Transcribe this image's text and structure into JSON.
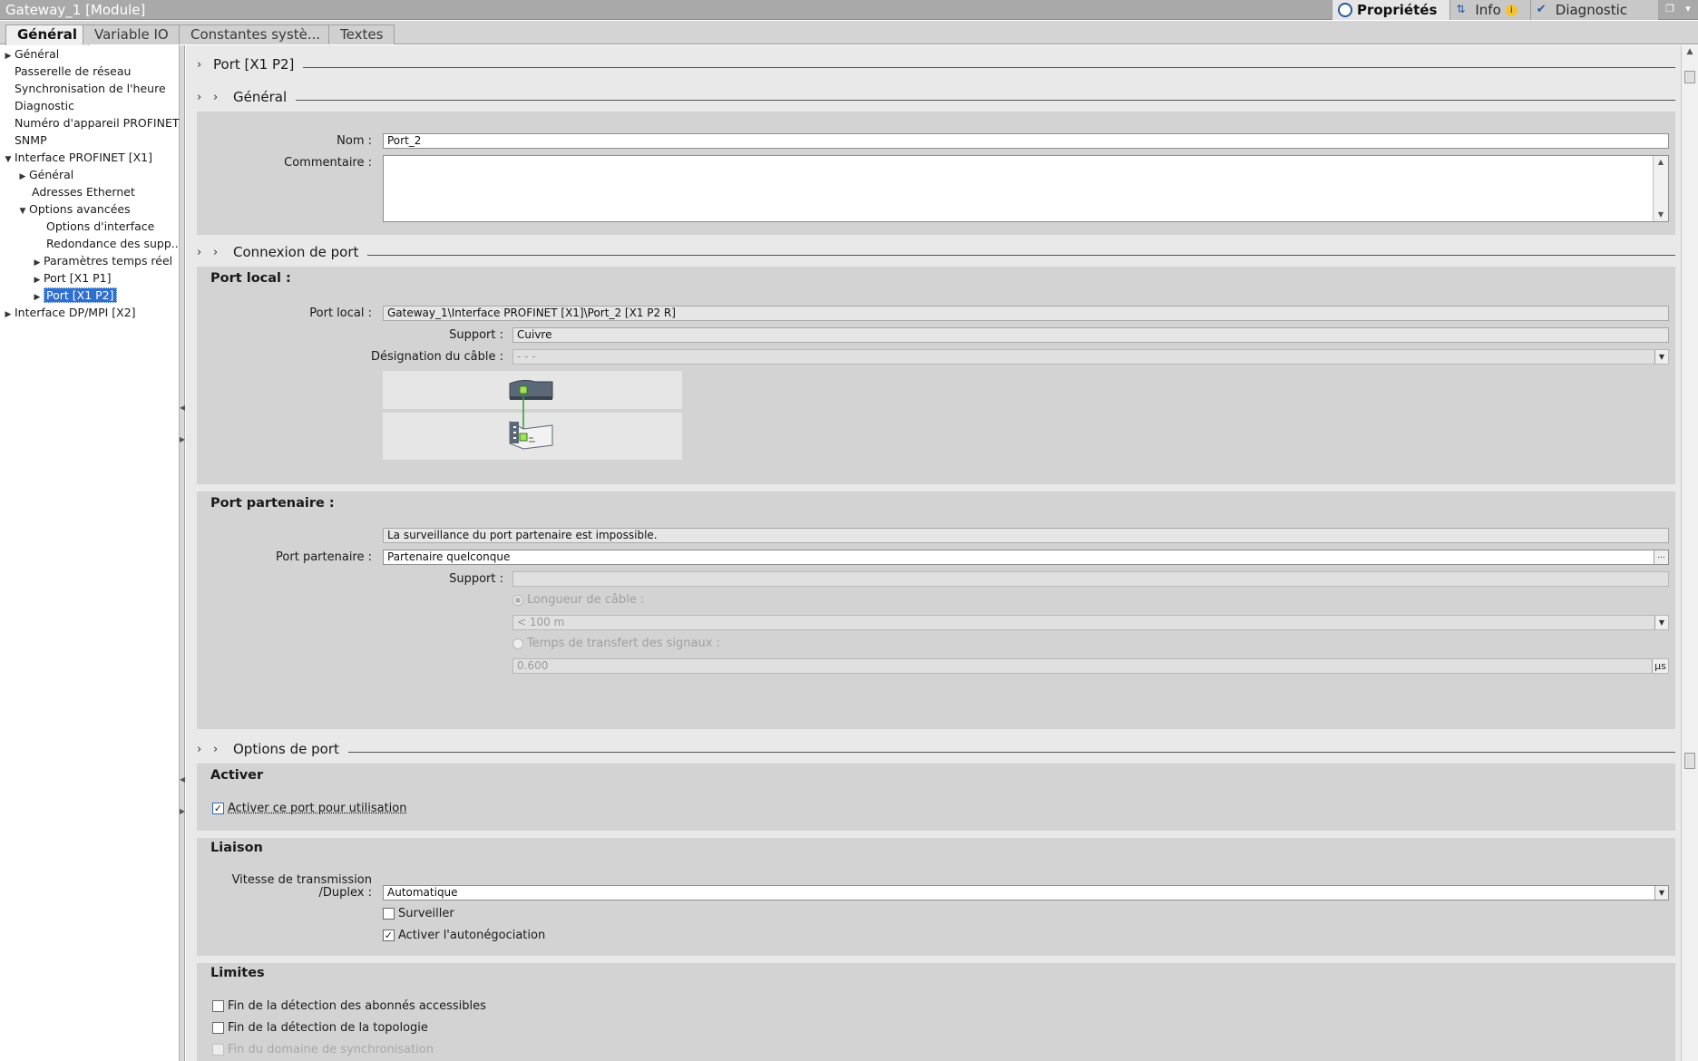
{
  "window": {
    "title": "Gateway_1 [Module]"
  },
  "top_tabs": [
    {
      "label": "Propriétés",
      "icon": "properties-icon"
    },
    {
      "label": "Info",
      "icon": "info-icon"
    },
    {
      "label": "Diagnostic",
      "icon": "diagnostic-icon"
    }
  ],
  "tabs": [
    "Général",
    "Variable IO",
    "Constantes systè...",
    "Textes"
  ],
  "tree": [
    {
      "label": "Général"
    },
    {
      "label": "Passerelle de réseau"
    },
    {
      "label": "Synchronisation de l'heure"
    },
    {
      "label": "Diagnostic"
    },
    {
      "label": "Numéro d'appareil PROFINET"
    },
    {
      "label": "SNMP"
    },
    {
      "label": "Interface PROFINET [X1]"
    },
    {
      "label": "Général"
    },
    {
      "label": "Adresses Ethernet"
    },
    {
      "label": "Options avancées"
    },
    {
      "label": "Options d'interface"
    },
    {
      "label": "Redondance des supp..."
    },
    {
      "label": "Paramètres temps réel"
    },
    {
      "label": "Port [X1 P1]"
    },
    {
      "label": "Port [X1 P2]"
    },
    {
      "label": "Interface DP/MPI [X2]"
    }
  ],
  "sections": {
    "port_header": "Port [X1 P2]",
    "general": "Général",
    "connexion": "Connexion de port",
    "options": "Options de port"
  },
  "general": {
    "nom_label": "Nom :",
    "nom_value": "Port_2",
    "commentaire_label": "Commentaire :"
  },
  "port_local": {
    "title": "Port local :",
    "port_label": "Port local :",
    "port_value": "Gateway_1\\Interface PROFINET [X1]\\Port_2 [X1 P2 R]",
    "support_label": "Support :",
    "support_value": "Cuivre",
    "cable_label": "Désignation du câble :",
    "cable_value": "- - -"
  },
  "port_partenaire": {
    "title": "Port partenaire :",
    "info_text": "La surveillance du port partenaire est impossible.",
    "port_label": "Port partenaire :",
    "port_value": "Partenaire quelconque",
    "support_label": "Support :",
    "support_value": "",
    "longueur_label": "Longueur de câble :",
    "longueur_value": "< 100 m",
    "temps_label": "Temps de transfert des signaux :",
    "temps_value": "0.600",
    "temps_unit": "µs"
  },
  "activer": {
    "title": "Activer",
    "checkbox_label": "Activer ce port pour utilisation",
    "checked": true
  },
  "liaison": {
    "title": "Liaison",
    "vitesse_label_1": "Vitesse de transmission",
    "vitesse_label_2": "/Duplex :",
    "vitesse_value": "Automatique",
    "surveiller_label": "Surveiller",
    "surveiller_checked": false,
    "auto_label": "Activer l'autonégociation",
    "auto_checked": true
  },
  "limites": {
    "title": "Limites",
    "item1": "Fin de la détection des abonnés accessibles",
    "item2": "Fin de la détection de la topologie",
    "item3": "Fin du domaine de synchronisation"
  },
  "colors": {
    "accent": "#2f6fd0",
    "panel": "#d3d3d3",
    "link_green": "#2e9e2e"
  }
}
